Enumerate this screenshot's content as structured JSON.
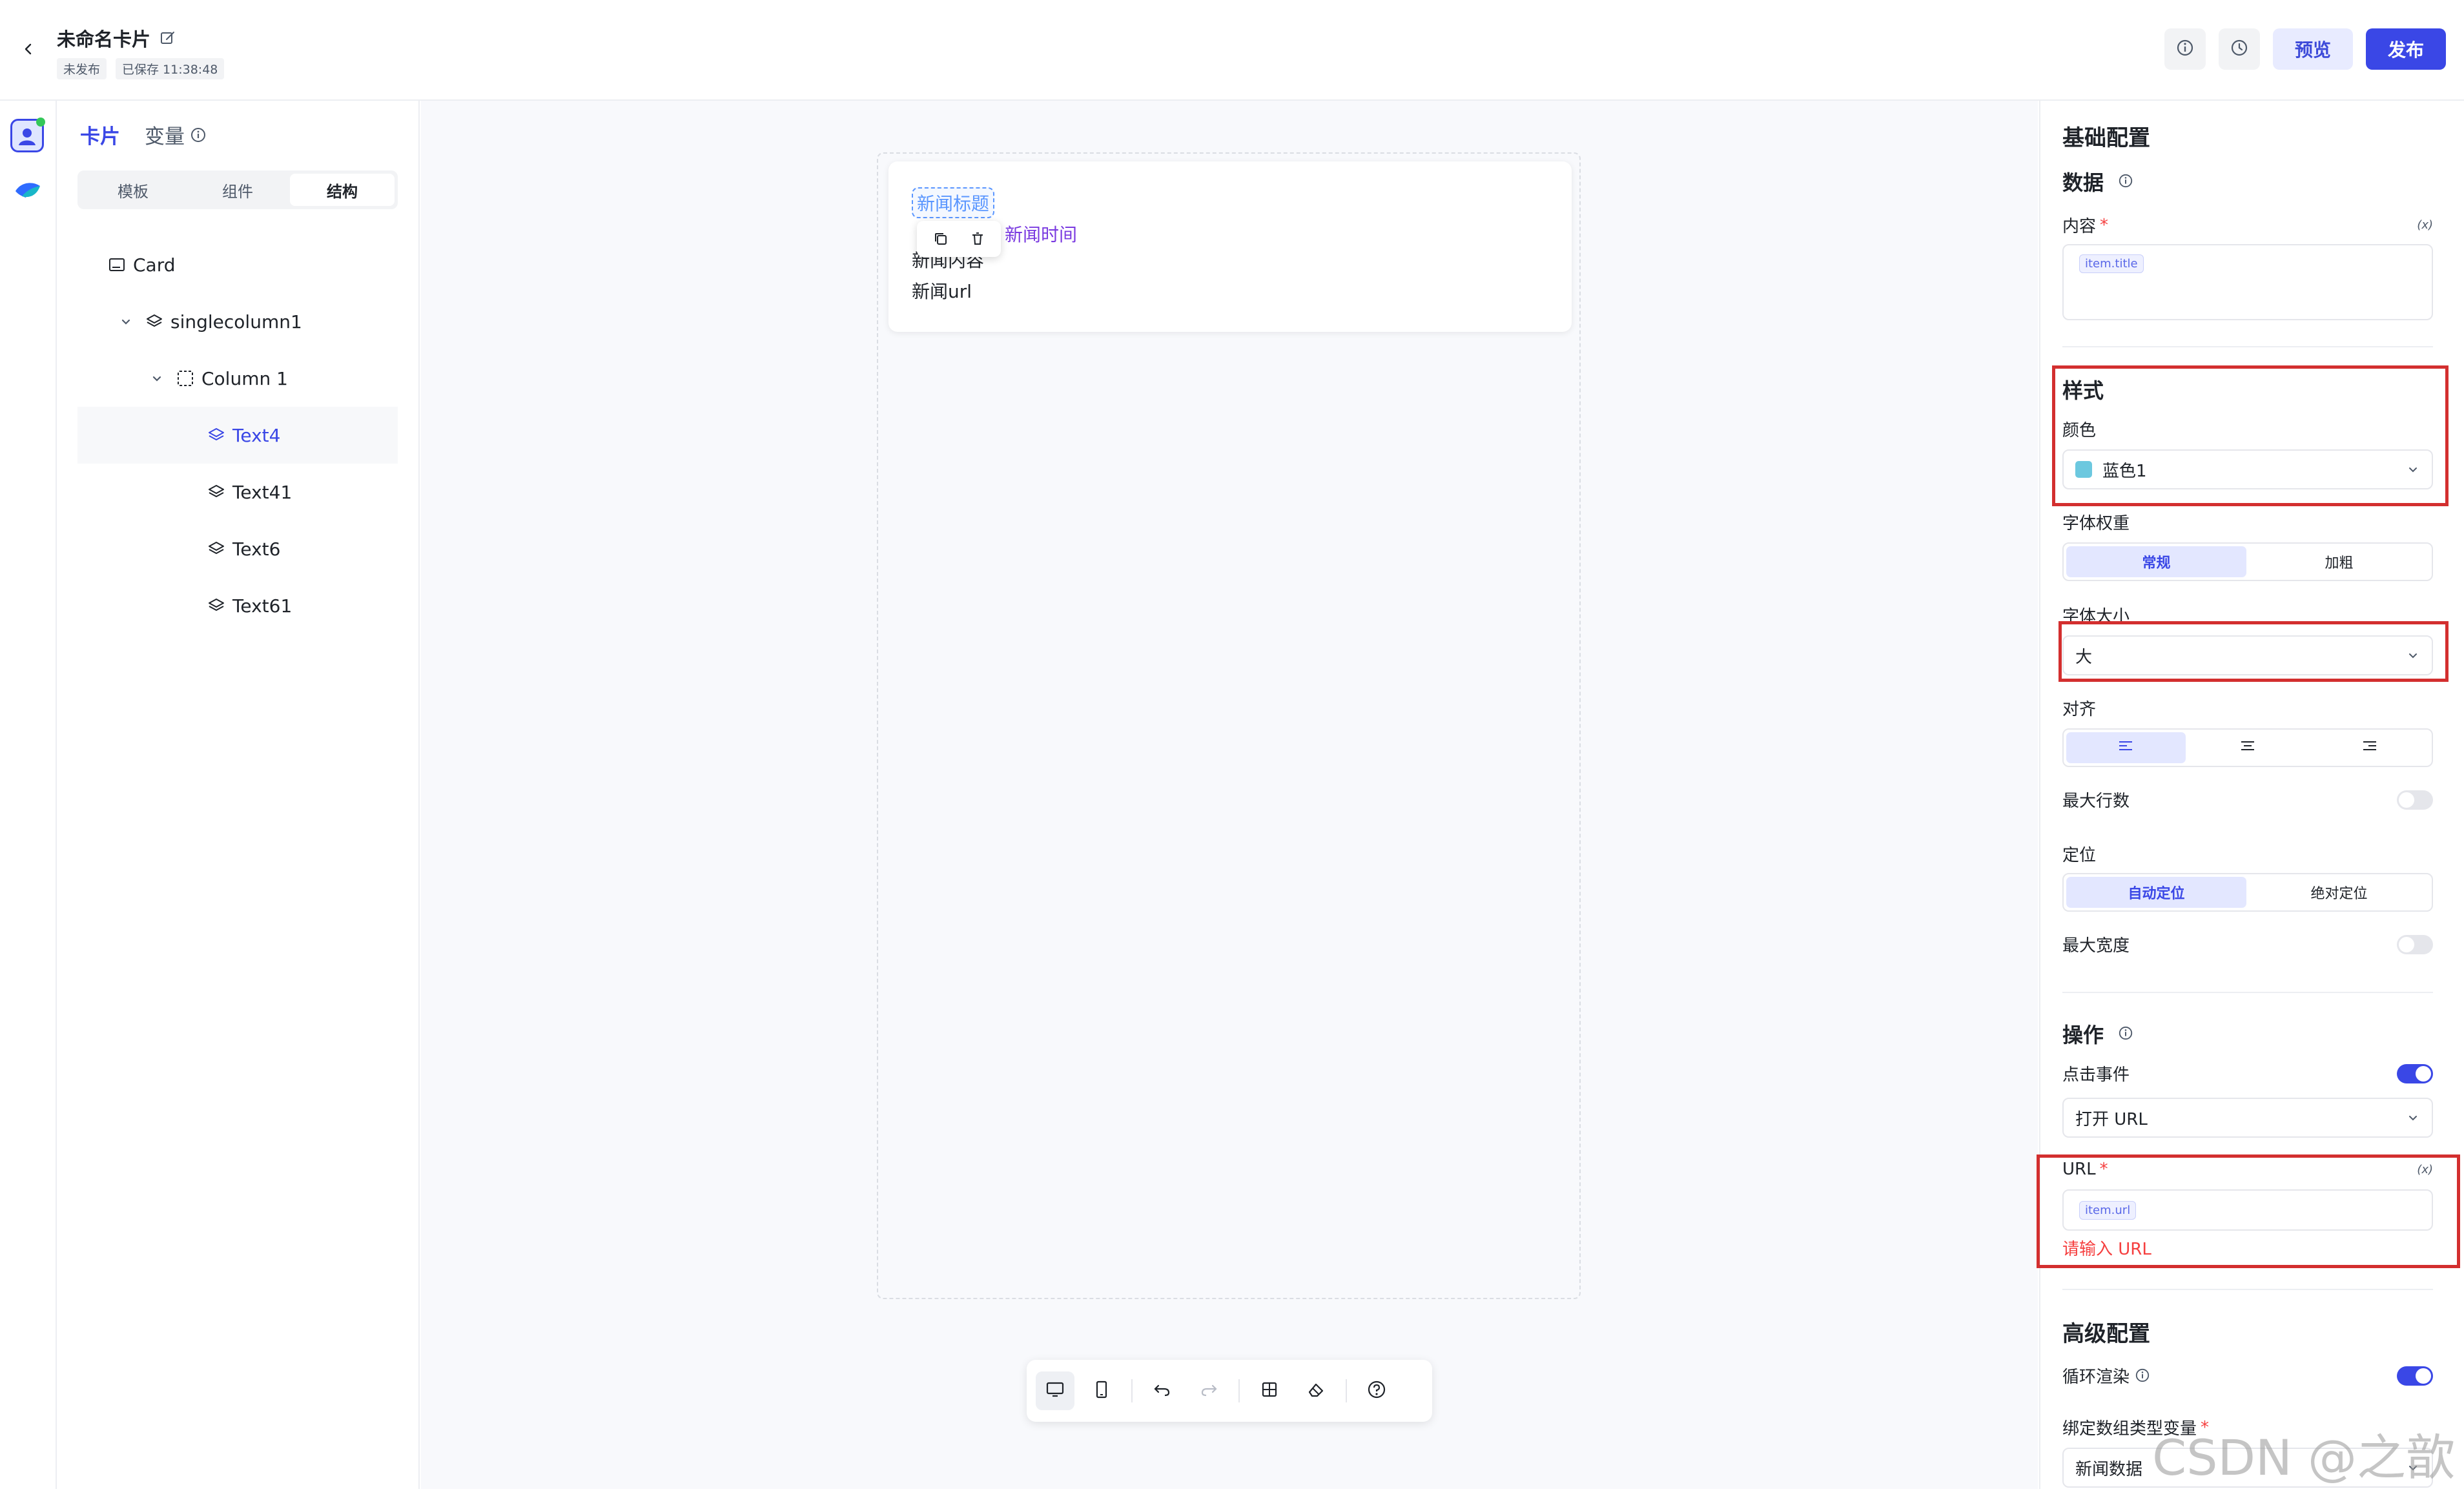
{
  "header": {
    "title": "未命名卡片",
    "status_badge": "未发布",
    "saved_badge": "已保存 11:38:48",
    "preview_label": "预览",
    "publish_label": "发布"
  },
  "left_panel": {
    "tabs": [
      "卡片",
      "变量"
    ],
    "segments": [
      "模板",
      "组件",
      "结构"
    ],
    "tree": {
      "card": "Card",
      "singlecolumn": "singlecolumn1",
      "column": "Column 1",
      "items": [
        "Text4",
        "Text41",
        "Text6",
        "Text61"
      ]
    }
  },
  "canvas": {
    "news_title": "新闻标题",
    "news_time": "新闻时间",
    "news_content": "新闻内容",
    "news_url": "新闻url"
  },
  "right_panel": {
    "basic_config": "基础配置",
    "data_section": "数据",
    "content_label": "内容",
    "content_value": "item.title",
    "fx_symbol": "(x)",
    "style_section": "样式",
    "color_label": "颜色",
    "color_value": "蓝色1",
    "color_swatch": "#6cc8df",
    "font_weight_label": "字体权重",
    "font_weight_options": [
      "常规",
      "加粗"
    ],
    "font_size_label": "字体大小",
    "font_size_value": "大",
    "align_label": "对齐",
    "max_lines_label": "最大行数",
    "position_label": "定位",
    "position_options": [
      "自动定位",
      "绝对定位"
    ],
    "max_width_label": "最大宽度",
    "action_section": "操作",
    "click_event_label": "点击事件",
    "click_event_value": "打开 URL",
    "url_label": "URL",
    "url_value": "item.url",
    "url_error": "请输入 URL",
    "advanced_section": "高级配置",
    "loop_render_label": "循环渲染",
    "bind_array_label": "绑定数组类型变量",
    "bind_array_value": "新闻数据"
  },
  "watermark": "CSDN @之歆",
  "colors": {
    "accent": "#3a47e6",
    "error": "#f53f3f",
    "highlight_box": "#d32f2f"
  }
}
